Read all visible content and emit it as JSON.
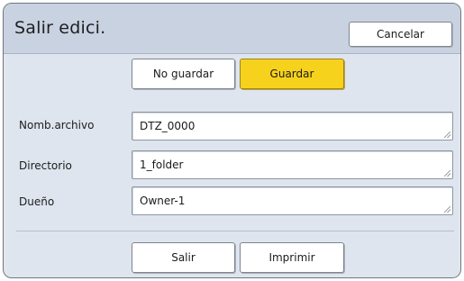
{
  "dialog": {
    "title": "Salir edici.",
    "cancel_label": "Cancelar",
    "no_save_label": "No guardar",
    "save_label": "Guardar",
    "exit_label": "Salir",
    "print_label": "Imprimir"
  },
  "fields": {
    "name_label": "Nomb.archivo",
    "name_value": "DTZ_0000",
    "directory_label": "Directorio",
    "directory_value": "1_folder",
    "owner_label": "Dueño",
    "owner_value": "Owner-1"
  },
  "colors": {
    "accent_button": "#f7d21c",
    "title_bar": "#c9d2e0",
    "panel": "#dfe5ef"
  }
}
